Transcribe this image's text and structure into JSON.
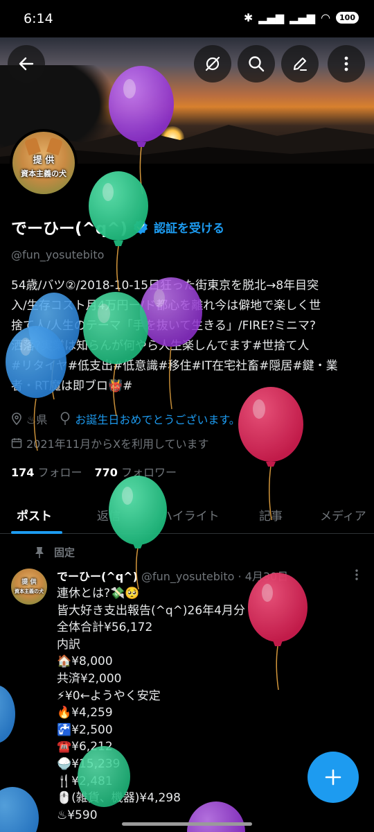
{
  "status_bar": {
    "time": "6:14",
    "battery": "100"
  },
  "profile": {
    "avatar_text_top": "提 供",
    "avatar_text_bottom": "資本主義の犬",
    "display_name": "でーひー(^q^)",
    "verify_label": "認証を受ける",
    "handle": "@fun_yosutebito",
    "bio_lines": [
      "54歳/バツ②/2018-10-15日狂った街東京を脱北→8年目突",
      "入/生存コスト月4万円ー/ド都心を離れ今は僻地で楽しく世",
      "捨て人/人生のテーマ「手を抜いて生きる」/FIRE?ミニマ?",
      "洒落?実業は知らんが何やら人生楽しんでます#世捨て人",
      "#リタイヤ#低支出#低意識#移住#IT在宅社畜#隠居#鍵・業",
      "者・RT魔は即ブロ👹#"
    ],
    "location": "♨県",
    "birthday_link": "お誕生日おめでとうございます。",
    "joined": "2021年11月からXを利用しています",
    "following_count": "174",
    "following_label": "フォロー",
    "followers_count": "770",
    "followers_label": "フォロワー"
  },
  "tabs": [
    {
      "label": "ポスト",
      "active": true
    },
    {
      "label": "返信",
      "active": false
    },
    {
      "label": "ハイライト",
      "active": false
    },
    {
      "label": "記事",
      "active": false
    },
    {
      "label": "メディア",
      "active": false
    }
  ],
  "pinned_label": "固定",
  "post": {
    "avatar_text_top": "提 供",
    "avatar_text_bottom": "資本主義の犬",
    "name": "でーひー(^q^)",
    "handle_date": "@fun_yosutebito · 4月30日",
    "lines": [
      "連休とは?💸🥺",
      "皆大好き支出報告(^q^)26年4月分",
      "全体合計¥56,172",
      "内訳",
      "🏠¥8,000",
      "共済¥2,000",
      "⚡¥0←ようやく安定",
      "🔥¥4,259",
      "🚰¥2,500",
      "☎️¥6,212",
      "🍚¥15,239",
      "🍴¥2,481",
      "🖱️(雑貨、機器)¥4,298",
      "♨¥590"
    ]
  },
  "colors": {
    "accent": "#1d9bf0",
    "background": "#000000",
    "muted_text": "#71767b",
    "balloon_purple": "#9b3fd6",
    "balloon_green": "#27c98a",
    "balloon_red": "#e0285a",
    "balloon_blue": "#2f8fe0"
  },
  "icons": [
    "back-arrow-icon",
    "no-sync-icon",
    "search-icon",
    "edit-icon",
    "more-vertical-icon",
    "verified-badge-icon",
    "location-icon",
    "balloon-icon",
    "calendar-icon",
    "pin-icon",
    "plus-icon"
  ]
}
